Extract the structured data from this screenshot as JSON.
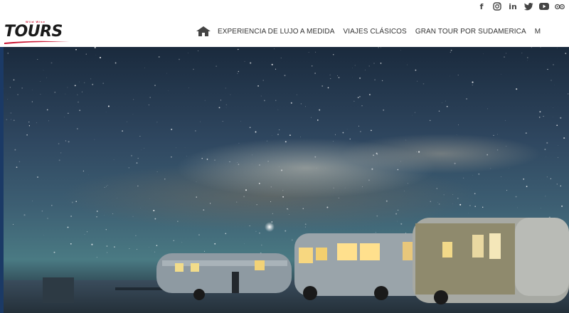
{
  "social": {
    "icons": [
      "facebook-icon",
      "instagram-icon",
      "linkedin-icon",
      "twitter-icon",
      "youtube-icon",
      "tripadvisor-icon"
    ]
  },
  "logo": {
    "small_text": "Wild Wise",
    "big_text": "TOURS"
  },
  "nav": {
    "home_icon": "home-icon",
    "items": [
      "EXPERIENCIA DE LUJO A MEDIDA",
      "VIAJES CLÁSICOS",
      "GRAN TOUR POR SUDAMERICA",
      "M"
    ]
  },
  "colors": {
    "brand_red": "#c8102e",
    "nav_text": "#333333"
  }
}
